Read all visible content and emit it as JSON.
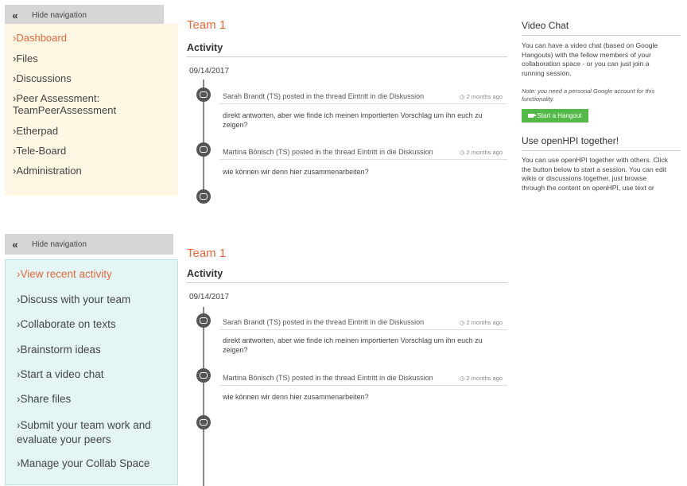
{
  "top": {
    "nav_toggle": "Hide navigation",
    "nav_items": [
      "Dashboard",
      "Files",
      "Discussions",
      "Peer Assessment:\nTeamPeerAssessment",
      "Etherpad",
      "Tele-Board",
      "Administration"
    ],
    "team": "Team 1",
    "activity": "Activity",
    "date": "09/14/2017",
    "entries": [
      {
        "head": "Sarah Brandt (TS) posted in the thread Eintritt in die Diskussion",
        "time": "2 months ago",
        "body": "direkt antworten, aber wie finde ich meinen importierten Vorschlag um ihn euch zu zeigen?"
      },
      {
        "head": "Martina Bönisch (TS) posted in the thread Eintritt in die Diskussion",
        "time": "2 months ago",
        "body": "wie können wir denn hier zusammenarbeiten?"
      }
    ],
    "video_chat": {
      "title": "Video Chat",
      "text": "You can have a video chat (based on Google Hangouts) with the fellow members of your collaboration space - or you can just join a running session.",
      "note": "Note: you need a personal Google account for this functionality.",
      "button": "Start a Hangout"
    },
    "openhpi": {
      "title": "Use openHPI together!",
      "text": "You can use openHPI together with others. Click the button below to start a session. You can edit wikis or discussions together, just browse through the content on openHPI, use text or"
    }
  },
  "bottom": {
    "nav_toggle": "Hide navigation",
    "nav_items": [
      "View recent activity",
      "Discuss with your team",
      "Collaborate on texts",
      "Brainstorm ideas",
      "Start a video chat",
      "Share files",
      "Submit your team work and\nevaluate your peers",
      "Manage your Collab Space"
    ],
    "team": "Team 1",
    "activity": "Activity",
    "date": "09/14/2017",
    "entries": [
      {
        "head": "Sarah Brandt (TS) posted in the thread Eintritt in die Diskussion",
        "time": "2 months ago",
        "body": "direkt antworten, aber wie finde ich meinen importierten Vorschlag um ihn euch zu zeigen?"
      },
      {
        "head": "Martina Bönisch (TS) posted in the thread Eintritt in die Diskussion",
        "time": "2 months ago",
        "body": "wie können wir denn hier zusammenarbeiten?"
      }
    ]
  },
  "colors": {
    "accent": "#e5683c",
    "hangout": "#54b948",
    "top_nav_bg": "#fdf7e4",
    "bottom_nav_bg": "#e3f6f5"
  },
  "icons": {
    "toggle": "double-chevron-left-icon",
    "timeline": "comment-icon",
    "time": "clock-icon",
    "hangout": "video-camera-icon"
  }
}
